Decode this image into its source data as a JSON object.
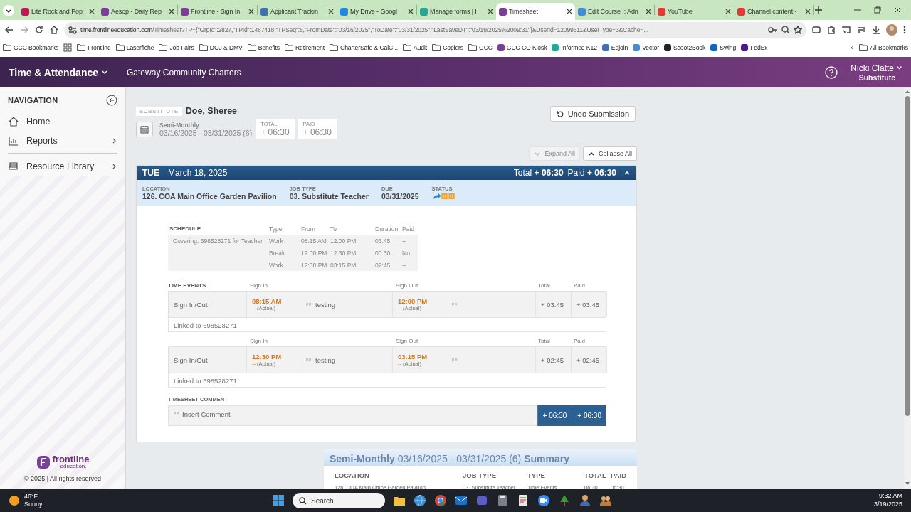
{
  "browser": {
    "tabs": [
      {
        "title": "Lite Rock and Pop",
        "selected": false,
        "color": "#c2185b"
      },
      {
        "title": "Aesop - Daily Rep",
        "selected": false,
        "color": "#7b3f98"
      },
      {
        "title": "Frontline - Sign In",
        "selected": false,
        "color": "#7b3f98"
      },
      {
        "title": "Applicant Trackin",
        "selected": false,
        "color": "#3f6fb5"
      },
      {
        "title": "My Drive - Googl",
        "selected": false,
        "color": "#1e88e5"
      },
      {
        "title": "Manage forms | I",
        "selected": false,
        "color": "#26a69a"
      },
      {
        "title": "Timesheet",
        "selected": true,
        "color": "#7b3f98"
      },
      {
        "title": "Edit Course :: Adn",
        "selected": false,
        "color": "#3f8fd6"
      },
      {
        "title": "YouTube",
        "selected": false,
        "color": "#e53935"
      },
      {
        "title": "Channel content -",
        "selected": false,
        "color": "#e53935"
      }
    ],
    "url_host": "time.frontlineeducation.com",
    "url_path": "/Timesheet?TP={\"GrpId\":2827,\"TPId\":1487418,\"TPSeq\":6,\"FromDate\":\"03/16/2025\",\"ToDate\":\"03/31/2025\",\"LastSaveDT\":\"03/19/2025%2009:31\"}&UserId=12099611&UserType=3&Cache=...",
    "bookmarks": [
      {
        "label": "GCC Bookmarks",
        "kind": "folder"
      },
      {
        "kind": "apps"
      },
      {
        "label": "Frontline",
        "kind": "folder"
      },
      {
        "label": "Laserfiche",
        "kind": "folder"
      },
      {
        "label": "Job Fairs",
        "kind": "folder"
      },
      {
        "label": "DOJ & DMV",
        "kind": "folder"
      },
      {
        "label": "Benefits",
        "kind": "folder"
      },
      {
        "label": "Retirement",
        "kind": "folder"
      },
      {
        "label": "CharterSafe & CalC...",
        "kind": "folder"
      },
      {
        "label": "Audit",
        "kind": "folder"
      },
      {
        "label": "Copiers",
        "kind": "folder"
      },
      {
        "label": "GCC",
        "kind": "folder"
      },
      {
        "label": "GCC CO Kiosk",
        "kind": "site",
        "color": "#7b3f98"
      },
      {
        "label": "Informed K12",
        "kind": "site",
        "color": "#26a69a"
      },
      {
        "label": "Edjoin",
        "kind": "site",
        "color": "#3f6fb5"
      },
      {
        "label": "Vector",
        "kind": "site",
        "color": "#3f8fd6"
      },
      {
        "label": "Scoot2Book",
        "kind": "site",
        "color": "#222222"
      },
      {
        "label": "Swing",
        "kind": "site",
        "color": "#1565c0"
      },
      {
        "label": "FedEx",
        "kind": "site",
        "color": "#4d148c"
      }
    ],
    "more": "»",
    "all_bookmarks": "All Bookmarks"
  },
  "app": {
    "product": "Time & Attendance",
    "org": "Gateway Community Charters",
    "user": {
      "name": "Nicki Clatte",
      "role": "Substitute"
    }
  },
  "sidebar": {
    "heading": "NAVIGATION",
    "items": [
      {
        "label": "Home",
        "kind": "home",
        "submenu": false
      },
      {
        "label": "Reports",
        "kind": "reports",
        "submenu": true
      },
      {
        "label": "Resource Library",
        "kind": "library",
        "submenu": true
      }
    ],
    "brand": "frontline",
    "brand_sub": "education.",
    "copyright": "© 2025 | All rights reserved"
  },
  "timesheet": {
    "role": "SUBSTITUTE",
    "name": "Doe, Sheree",
    "period_type": "Semi-Monthly",
    "period": "03/16/2025 - 03/31/2025 (6)",
    "totals": [
      {
        "label": "TOTAL",
        "value": "+ 06:30"
      },
      {
        "label": "PAID",
        "value": "+ 06:30"
      }
    ],
    "undo": "Undo Submission",
    "expand": {
      "label": "Expand All",
      "disabled": true
    },
    "collapse": {
      "label": "Collapse All",
      "disabled": false
    },
    "day": {
      "weekday": "TUE",
      "date": "March 18, 2025",
      "total_label": "Total",
      "total": "+ 06:30",
      "paid_label": "Paid",
      "paid": "+ 06:30",
      "expanded": true,
      "info": [
        {
          "label": "LOCATION",
          "value": "126. COA Main Office Garden Pavilion"
        },
        {
          "label": "JOB TYPE",
          "value": "03. Substitute Teacher"
        },
        {
          "label": "DUE",
          "value": "03/31/2025"
        }
      ],
      "status_label": "STATUS",
      "schedule": {
        "heading": "SCHEDULE",
        "columns": [
          "Type",
          "From",
          "To",
          "Duration",
          "Paid"
        ],
        "covering": "Covering: 698528271 for Teacher",
        "rows": [
          [
            "Work",
            "08:15 AM",
            "12:00 PM",
            "03:45",
            "--"
          ],
          [
            "Break",
            "12:00 PM",
            "12:30 PM",
            "00:30",
            "No"
          ],
          [
            "Work",
            "12:30 PM",
            "03:15 PM",
            "02:45",
            "--"
          ]
        ]
      },
      "events_heading": "TIME EVENTS",
      "events": [
        {
          "sign_in_label": "Sign In",
          "sign_out_label": "Sign Out",
          "total_label": "Total",
          "paid_label": "Paid",
          "type": "Sign In/Out",
          "in_time": "08:15 AM",
          "in_note": "-- (Actual)",
          "in_comment": "testing",
          "out_time": "12:00 PM",
          "out_note": "-- (Actual)",
          "total": "+ 03:45",
          "paid": "+ 03:45",
          "linked": "Linked to 698528271"
        },
        {
          "sign_in_label": "Sign In",
          "sign_out_label": "Sign Out",
          "total_label": "Total",
          "paid_label": "Paid",
          "type": "Sign In/Out",
          "in_time": "12:30 PM",
          "in_note": "-- (Actual)",
          "in_comment": "testing",
          "out_time": "03:15 PM",
          "out_note": "-- (Actual)",
          "total": "+ 02:45",
          "paid": "+ 02:45",
          "linked": "Linked to 698528271"
        }
      ],
      "comment_heading": "TIMESHEET COMMENT",
      "comment_placeholder": "Insert Comment",
      "comment_totals": [
        "+ 06:30",
        "+ 06:30"
      ]
    },
    "summary": {
      "title": "**Semi-Monthly** 03/16/2025 - 03/31/2025 (6) **Summary**",
      "columns": [
        "LOCATION",
        "JOB TYPE",
        "TYPE",
        "TOTAL",
        "PAID"
      ],
      "row": [
        "126. COA Main Office Garden Pavilion",
        "03. Substitute Teacher",
        "Time Events",
        "06:30",
        "06:30"
      ]
    }
  },
  "taskbar": {
    "temp": "46°F",
    "weather": "Sunny",
    "search": "Search",
    "time": "9:32 AM",
    "date": "3/19/2025"
  }
}
